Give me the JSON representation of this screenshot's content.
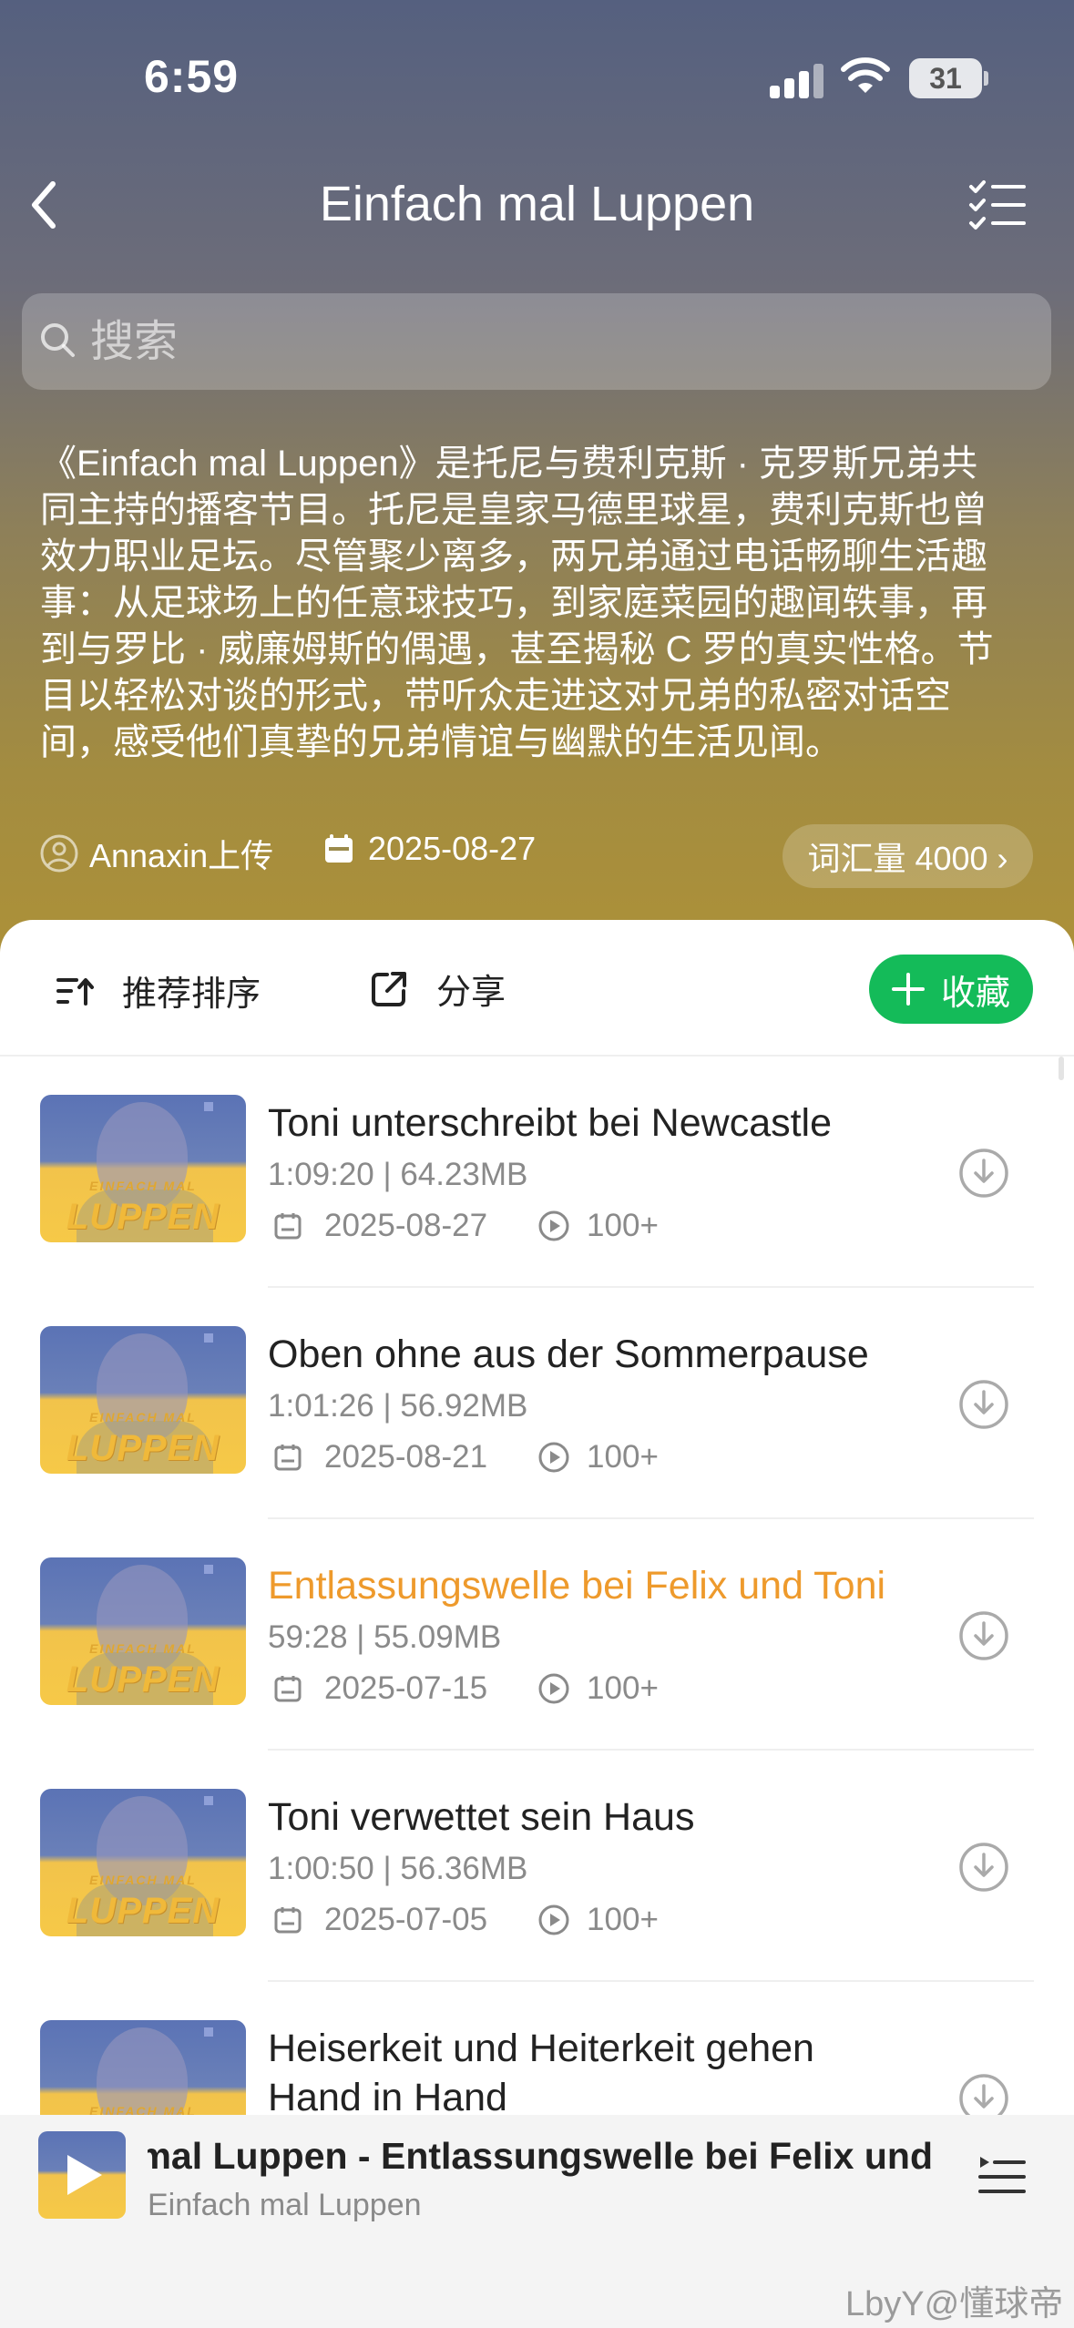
{
  "status_bar": {
    "time": "6:59",
    "battery": "31"
  },
  "nav": {
    "title": "Einfach mal Luppen"
  },
  "search": {
    "placeholder": "搜索"
  },
  "description": {
    "lines": [
      "《Einfach mal Luppen》是托尼与费利克斯 · 克罗斯兄弟共",
      "同主持的播客节目。托尼是皇家马德里球星，费利克斯也曾",
      "效力职业足坛。尽管聚少离多，两兄弟通过电话畅聊生活趣",
      "事：从足球场上的任意球技巧，到家庭菜园的趣闻轶事，再",
      "到与罗比 · 威廉姆斯的偶遇，甚至揭秘 C 罗的真实性格。节",
      "目以轻松对谈的形式，带听众走进这对兄弟的私密对话空",
      "间，感受他们真挚的兄弟情谊与幽默的生活见闻。"
    ]
  },
  "meta": {
    "uploader": "Annaxin上传",
    "date": "2025-08-27",
    "vocab_label": "词汇量 4000 ›"
  },
  "toolbar": {
    "sort_label": "推荐排序",
    "share_label": "分享",
    "favorite_label": "收藏"
  },
  "thumb_text": {
    "line1": "EINFACH MAL",
    "line2": "LUPPEN"
  },
  "episodes": [
    {
      "title": "Toni unterschreibt bei Newcastle",
      "duration_size": "1:09:20  |  64.23MB",
      "date": "2025-08-27",
      "plays": "100+",
      "active": false
    },
    {
      "title": "Oben ohne aus der Sommerpause",
      "duration_size": "1:01:26  |  56.92MB",
      "date": "2025-08-21",
      "plays": "100+",
      "active": false
    },
    {
      "title": "Entlassungswelle bei Felix und Toni",
      "duration_size": "59:28  |  55.09MB",
      "date": "2025-07-15",
      "plays": "100+",
      "active": true
    },
    {
      "title": "Toni verwettet sein Haus",
      "duration_size": "1:00:50  |  56.36MB",
      "date": "2025-07-05",
      "plays": "100+",
      "active": false
    },
    {
      "title": "Heiserkeit und Heiterkeit gehen",
      "title_line2": "Hand in Hand",
      "active": false
    }
  ],
  "player": {
    "title": "Einfach mal Luppen - Entlassungswelle bei Felix und Toni",
    "subtitle": "Einfach mal Luppen"
  },
  "watermark": "LbyY@懂球帝",
  "colors": {
    "accent_green": "#14bb59",
    "active_orange": "#ee9a2c"
  }
}
